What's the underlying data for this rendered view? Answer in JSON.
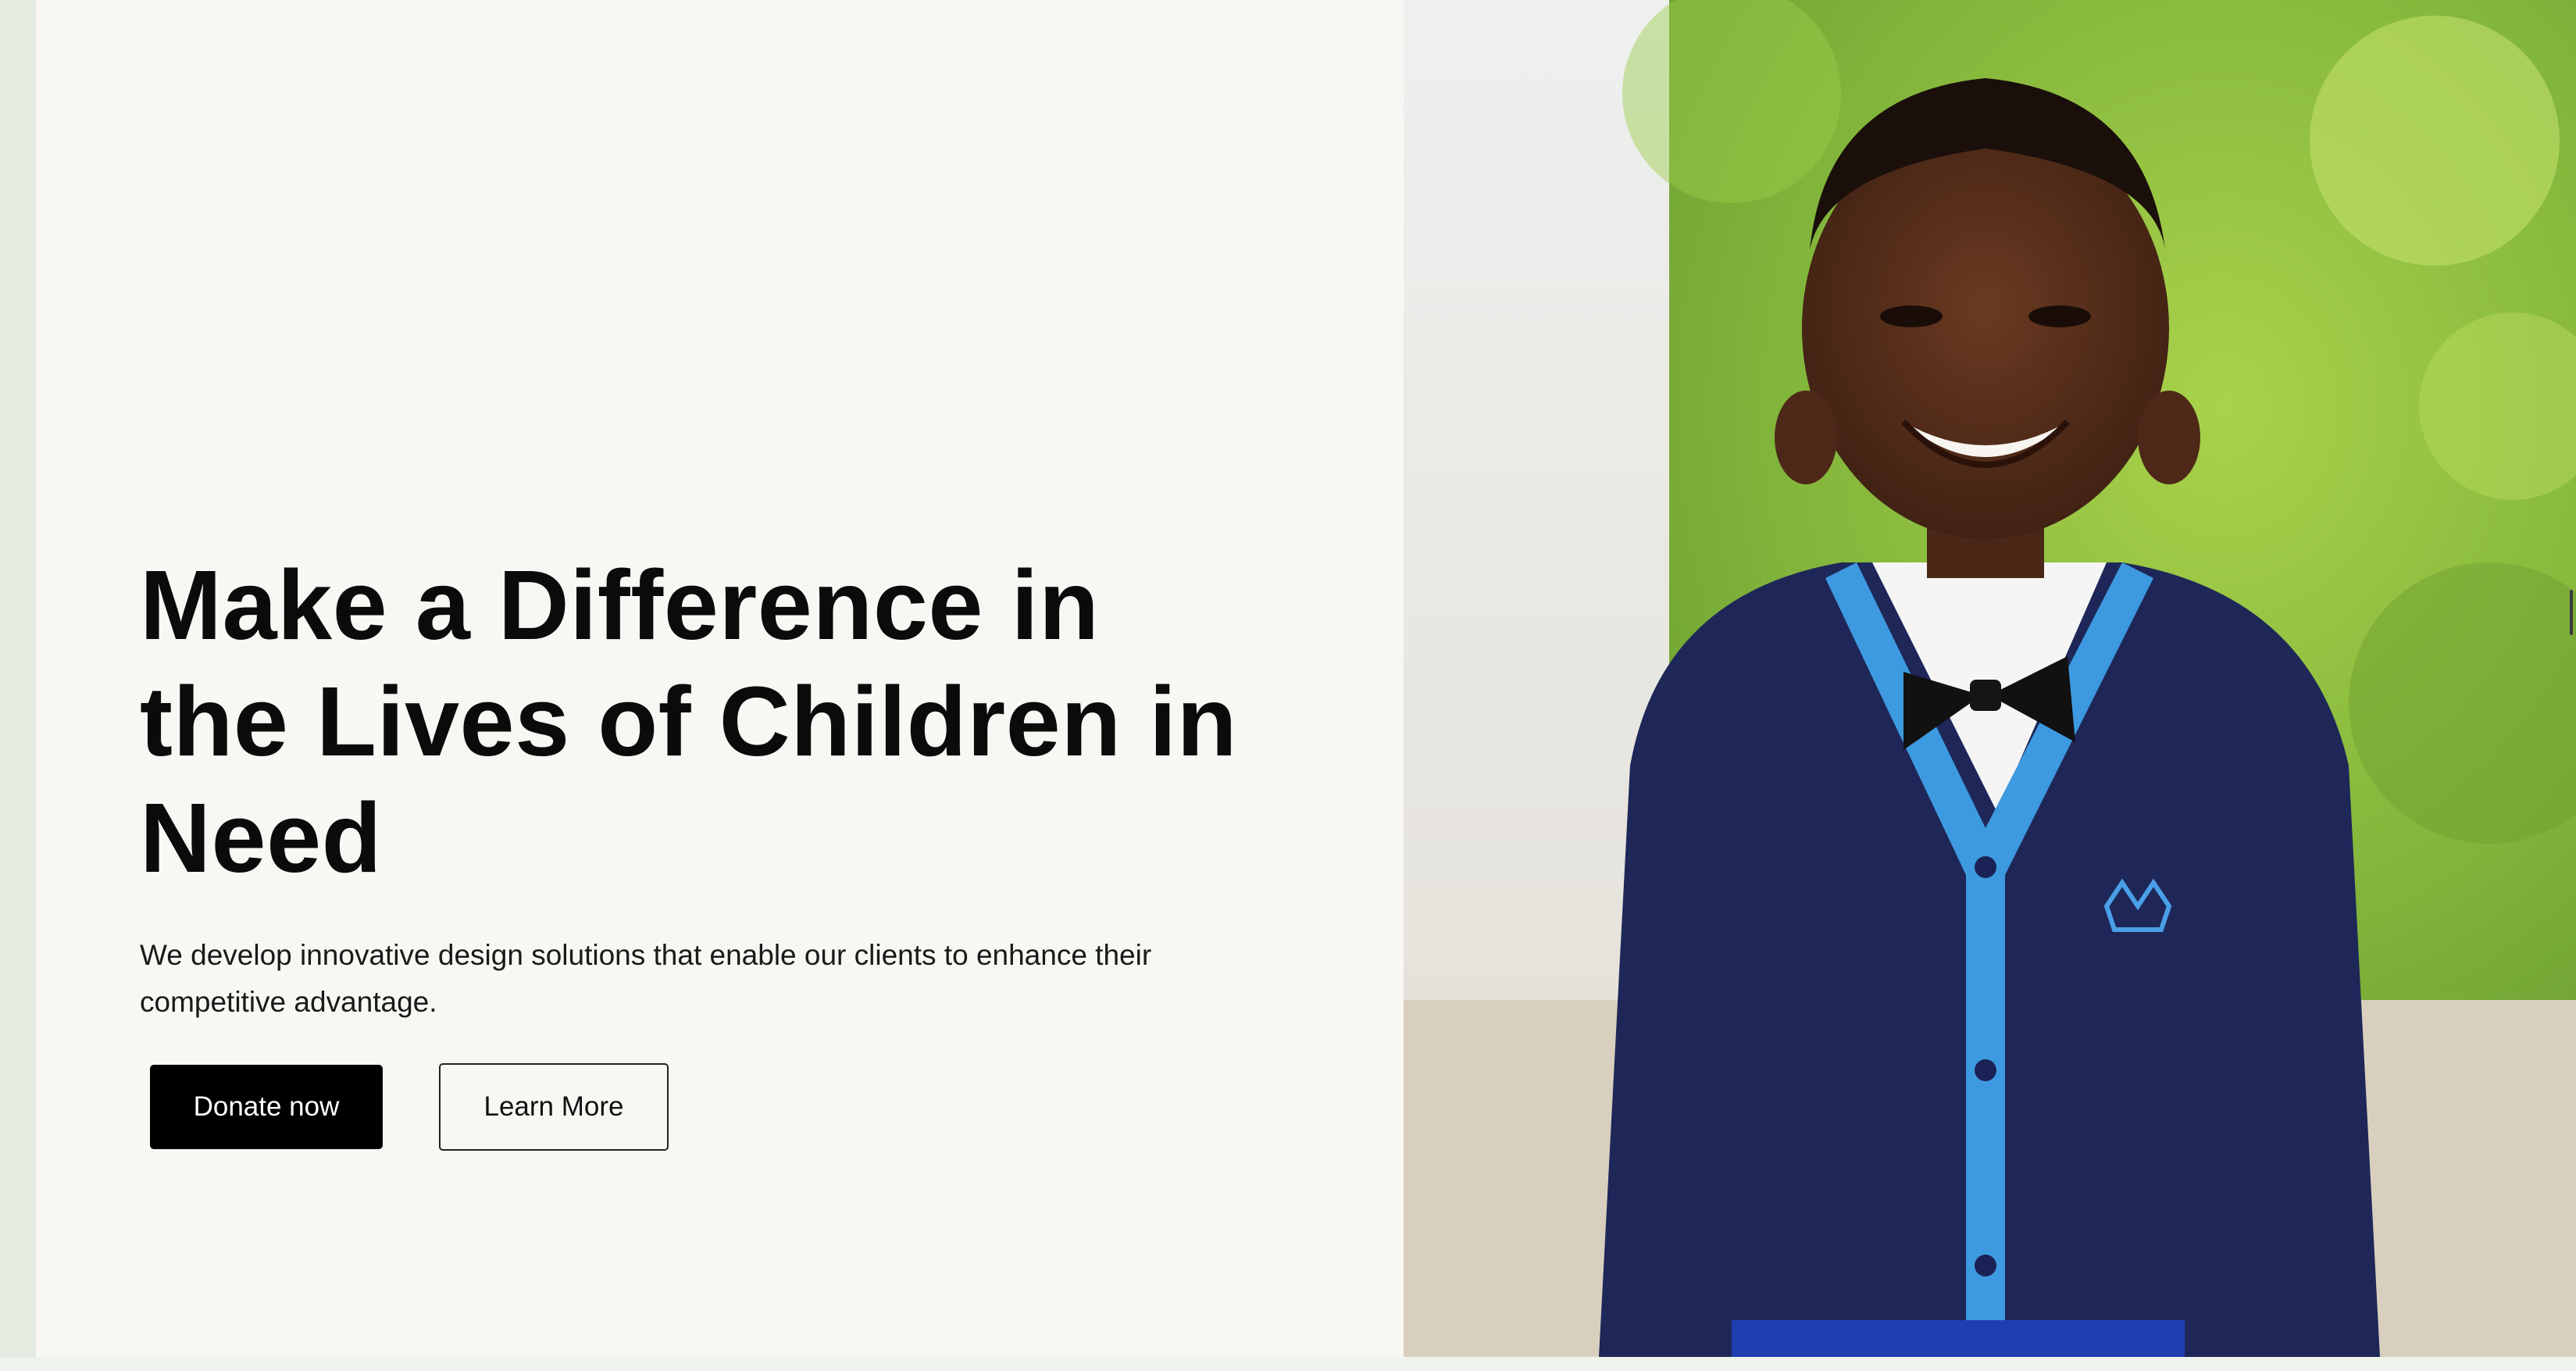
{
  "hero": {
    "headline": "Make a Difference in the Lives of Children in Need",
    "subtext": "We develop innovative design solutions that enable our clients to enhance their competitive advantage.",
    "primary_cta": "Donate now",
    "secondary_cta": "Learn More"
  },
  "colors": {
    "background": "#f9f7f3",
    "primary_button": "#000000",
    "primary_button_text": "#ffffff",
    "text": "#0b0b0b"
  }
}
